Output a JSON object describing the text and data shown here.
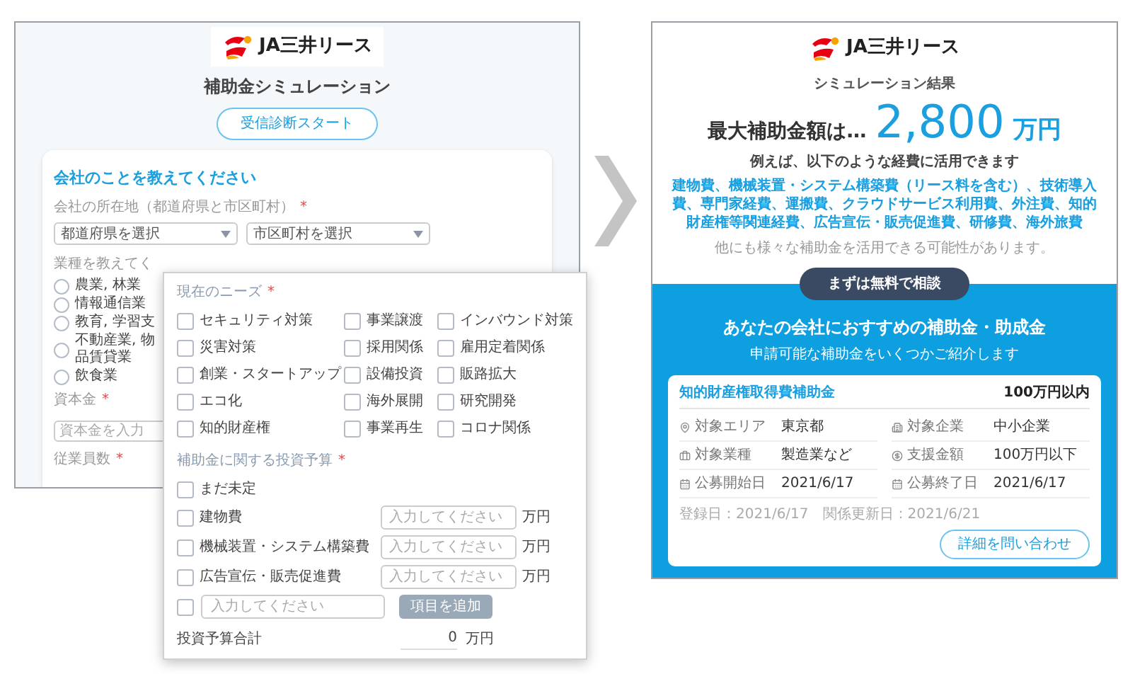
{
  "left_screen": {
    "logo": "JA三井リース",
    "title": "補助金シミュレーション",
    "start_button": "受信診断スタート",
    "form": {
      "heading": "会社のことを教えてください",
      "location_label": "会社の所在地（都道府県と市区町村）",
      "location_mark": "*",
      "selects": [
        "都道府県を選択",
        "市区町村を選択"
      ],
      "industry_label": "業種を教えてく",
      "industries": [
        {
          "label": "農業, 林業",
          "selected": false
        },
        {
          "label": "情報通信業",
          "selected": false
        },
        {
          "label": "教育, 学習支",
          "selected": false
        },
        {
          "label": "不動産業, 物品賃貸業",
          "selected": false
        },
        {
          "label": "飲食業",
          "selected": false
        }
      ],
      "capital_label": "資本金",
      "capital_mark": "*",
      "capital_placeholder": "資本金を入力",
      "employees_label": "従業員数",
      "employees_mark": "*"
    }
  },
  "needs_panel": {
    "needs_label": "現在のニーズ",
    "needs_mark": "*",
    "needs": [
      {
        "label": "セキュリティ対策",
        "checked": false
      },
      {
        "label": "事業譲渡",
        "checked": false
      },
      {
        "label": "インバウンド対策",
        "checked": false
      },
      {
        "label": "災害対策",
        "checked": false
      },
      {
        "label": "採用関係",
        "checked": false
      },
      {
        "label": "雇用定着関係",
        "checked": false
      },
      {
        "label": "創業・スタートアップ",
        "checked": false
      },
      {
        "label": "設備投資",
        "checked": false
      },
      {
        "label": "販路拡大",
        "checked": false
      },
      {
        "label": "エコ化",
        "checked": false
      },
      {
        "label": "海外展開",
        "checked": false
      },
      {
        "label": "研究開発",
        "checked": false
      },
      {
        "label": "知的財産権",
        "checked": false
      },
      {
        "label": "事業再生",
        "checked": false
      },
      {
        "label": "コロナ関係",
        "checked": false
      }
    ],
    "budget_label": "補助金に関する投資予算",
    "budget_mark": "*",
    "undecided": {
      "label": "まだ未定",
      "checked": false
    },
    "budget_items": [
      {
        "label": "建物費",
        "checked": false,
        "placeholder": "入力してください",
        "unit": "万円"
      },
      {
        "label": "機械装置・システム構築費",
        "checked": false,
        "placeholder": "入力してください",
        "unit": "万円"
      },
      {
        "label": "広告宣伝・販売促進費",
        "checked": false,
        "placeholder": "入力してください",
        "unit": "万円"
      }
    ],
    "custom_item": {
      "checked": false,
      "placeholder": "入力してください",
      "button": "項目を追加"
    },
    "total": {
      "label": "投資予算合計",
      "value": "0",
      "unit": "万円"
    }
  },
  "right_screen": {
    "logo": "JA三井リース",
    "title": "シミュレーション結果",
    "max_label": "最大補助金額は…",
    "max_amount": "2,800",
    "max_unit": "万円",
    "examples_heading": "例えば、以下のような経費に活用できます",
    "examples": "建物費、機械装置・システム構築費（リース料を含む）、技術導入費、専門家経費、運搬費、クラウドサービス利用費、外注費、知的財産権等関連経費、広告宣伝・販売促進費、研修費、海外旅費",
    "other_note": "他にも様々な補助金を活用できる可能性があります。",
    "consult_button": "まずは無料で相談",
    "section_title": "あなたの会社におすすめの補助金・助成金",
    "section_subtitle": "申請可能な補助金をいくつかご紹介します",
    "card": {
      "title": "知的財産権取得費補助金",
      "amount": "100万円以内",
      "details": [
        {
          "kind": "place",
          "label": "対象エリア",
          "value": "東京都"
        },
        {
          "kind": "company",
          "label": "対象企業",
          "value": "中小企業"
        },
        {
          "kind": "industry",
          "label": "対象業種",
          "value": "製造業など"
        },
        {
          "kind": "money",
          "label": "支援金額",
          "value": "100万円以下"
        },
        {
          "kind": "date",
          "label": "公募開始日",
          "value": "2021/6/17"
        },
        {
          "kind": "date",
          "label": "公募終了日",
          "value": "2021/6/17"
        }
      ],
      "registered": "登録日：2021/6/17",
      "updated": "関係更新日：2021/6/21",
      "button": "詳細を問い合わせ"
    }
  }
}
